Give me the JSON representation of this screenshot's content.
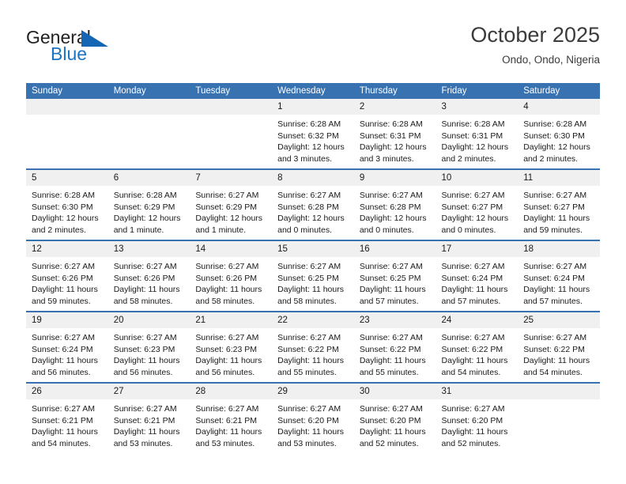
{
  "brand": {
    "line1": "General",
    "line2": "Blue",
    "mark": "triangle-logo"
  },
  "header": {
    "title": "October 2025",
    "subtitle": "Ondo, Ondo, Nigeria"
  },
  "colors": {
    "header_blue": "#3972b1",
    "brand_blue": "#1a73c4",
    "daynum_band": "#f0f0f0",
    "text": "#1a1a1a"
  },
  "weekdays": [
    "Sunday",
    "Monday",
    "Tuesday",
    "Wednesday",
    "Thursday",
    "Friday",
    "Saturday"
  ],
  "labels": {
    "sunrise_prefix": "Sunrise: ",
    "sunset_prefix": "Sunset: ",
    "daylight_prefix": "Daylight: "
  },
  "weeks": [
    [
      {
        "day": "",
        "blank": true
      },
      {
        "day": "",
        "blank": true
      },
      {
        "day": "",
        "blank": true
      },
      {
        "day": "1",
        "sunrise": "Sunrise: 6:28 AM",
        "sunset": "Sunset: 6:32 PM",
        "daylight": "Daylight: 12 hours and 3 minutes."
      },
      {
        "day": "2",
        "sunrise": "Sunrise: 6:28 AM",
        "sunset": "Sunset: 6:31 PM",
        "daylight": "Daylight: 12 hours and 3 minutes."
      },
      {
        "day": "3",
        "sunrise": "Sunrise: 6:28 AM",
        "sunset": "Sunset: 6:31 PM",
        "daylight": "Daylight: 12 hours and 2 minutes."
      },
      {
        "day": "4",
        "sunrise": "Sunrise: 6:28 AM",
        "sunset": "Sunset: 6:30 PM",
        "daylight": "Daylight: 12 hours and 2 minutes."
      }
    ],
    [
      {
        "day": "5",
        "sunrise": "Sunrise: 6:28 AM",
        "sunset": "Sunset: 6:30 PM",
        "daylight": "Daylight: 12 hours and 2 minutes."
      },
      {
        "day": "6",
        "sunrise": "Sunrise: 6:28 AM",
        "sunset": "Sunset: 6:29 PM",
        "daylight": "Daylight: 12 hours and 1 minute."
      },
      {
        "day": "7",
        "sunrise": "Sunrise: 6:27 AM",
        "sunset": "Sunset: 6:29 PM",
        "daylight": "Daylight: 12 hours and 1 minute."
      },
      {
        "day": "8",
        "sunrise": "Sunrise: 6:27 AM",
        "sunset": "Sunset: 6:28 PM",
        "daylight": "Daylight: 12 hours and 0 minutes."
      },
      {
        "day": "9",
        "sunrise": "Sunrise: 6:27 AM",
        "sunset": "Sunset: 6:28 PM",
        "daylight": "Daylight: 12 hours and 0 minutes."
      },
      {
        "day": "10",
        "sunrise": "Sunrise: 6:27 AM",
        "sunset": "Sunset: 6:27 PM",
        "daylight": "Daylight: 12 hours and 0 minutes."
      },
      {
        "day": "11",
        "sunrise": "Sunrise: 6:27 AM",
        "sunset": "Sunset: 6:27 PM",
        "daylight": "Daylight: 11 hours and 59 minutes."
      }
    ],
    [
      {
        "day": "12",
        "sunrise": "Sunrise: 6:27 AM",
        "sunset": "Sunset: 6:26 PM",
        "daylight": "Daylight: 11 hours and 59 minutes."
      },
      {
        "day": "13",
        "sunrise": "Sunrise: 6:27 AM",
        "sunset": "Sunset: 6:26 PM",
        "daylight": "Daylight: 11 hours and 58 minutes."
      },
      {
        "day": "14",
        "sunrise": "Sunrise: 6:27 AM",
        "sunset": "Sunset: 6:26 PM",
        "daylight": "Daylight: 11 hours and 58 minutes."
      },
      {
        "day": "15",
        "sunrise": "Sunrise: 6:27 AM",
        "sunset": "Sunset: 6:25 PM",
        "daylight": "Daylight: 11 hours and 58 minutes."
      },
      {
        "day": "16",
        "sunrise": "Sunrise: 6:27 AM",
        "sunset": "Sunset: 6:25 PM",
        "daylight": "Daylight: 11 hours and 57 minutes."
      },
      {
        "day": "17",
        "sunrise": "Sunrise: 6:27 AM",
        "sunset": "Sunset: 6:24 PM",
        "daylight": "Daylight: 11 hours and 57 minutes."
      },
      {
        "day": "18",
        "sunrise": "Sunrise: 6:27 AM",
        "sunset": "Sunset: 6:24 PM",
        "daylight": "Daylight: 11 hours and 57 minutes."
      }
    ],
    [
      {
        "day": "19",
        "sunrise": "Sunrise: 6:27 AM",
        "sunset": "Sunset: 6:24 PM",
        "daylight": "Daylight: 11 hours and 56 minutes."
      },
      {
        "day": "20",
        "sunrise": "Sunrise: 6:27 AM",
        "sunset": "Sunset: 6:23 PM",
        "daylight": "Daylight: 11 hours and 56 minutes."
      },
      {
        "day": "21",
        "sunrise": "Sunrise: 6:27 AM",
        "sunset": "Sunset: 6:23 PM",
        "daylight": "Daylight: 11 hours and 56 minutes."
      },
      {
        "day": "22",
        "sunrise": "Sunrise: 6:27 AM",
        "sunset": "Sunset: 6:22 PM",
        "daylight": "Daylight: 11 hours and 55 minutes."
      },
      {
        "day": "23",
        "sunrise": "Sunrise: 6:27 AM",
        "sunset": "Sunset: 6:22 PM",
        "daylight": "Daylight: 11 hours and 55 minutes."
      },
      {
        "day": "24",
        "sunrise": "Sunrise: 6:27 AM",
        "sunset": "Sunset: 6:22 PM",
        "daylight": "Daylight: 11 hours and 54 minutes."
      },
      {
        "day": "25",
        "sunrise": "Sunrise: 6:27 AM",
        "sunset": "Sunset: 6:22 PM",
        "daylight": "Daylight: 11 hours and 54 minutes."
      }
    ],
    [
      {
        "day": "26",
        "sunrise": "Sunrise: 6:27 AM",
        "sunset": "Sunset: 6:21 PM",
        "daylight": "Daylight: 11 hours and 54 minutes."
      },
      {
        "day": "27",
        "sunrise": "Sunrise: 6:27 AM",
        "sunset": "Sunset: 6:21 PM",
        "daylight": "Daylight: 11 hours and 53 minutes."
      },
      {
        "day": "28",
        "sunrise": "Sunrise: 6:27 AM",
        "sunset": "Sunset: 6:21 PM",
        "daylight": "Daylight: 11 hours and 53 minutes."
      },
      {
        "day": "29",
        "sunrise": "Sunrise: 6:27 AM",
        "sunset": "Sunset: 6:20 PM",
        "daylight": "Daylight: 11 hours and 53 minutes."
      },
      {
        "day": "30",
        "sunrise": "Sunrise: 6:27 AM",
        "sunset": "Sunset: 6:20 PM",
        "daylight": "Daylight: 11 hours and 52 minutes."
      },
      {
        "day": "31",
        "sunrise": "Sunrise: 6:27 AM",
        "sunset": "Sunset: 6:20 PM",
        "daylight": "Daylight: 11 hours and 52 minutes."
      },
      {
        "day": "",
        "blank": true
      }
    ]
  ]
}
